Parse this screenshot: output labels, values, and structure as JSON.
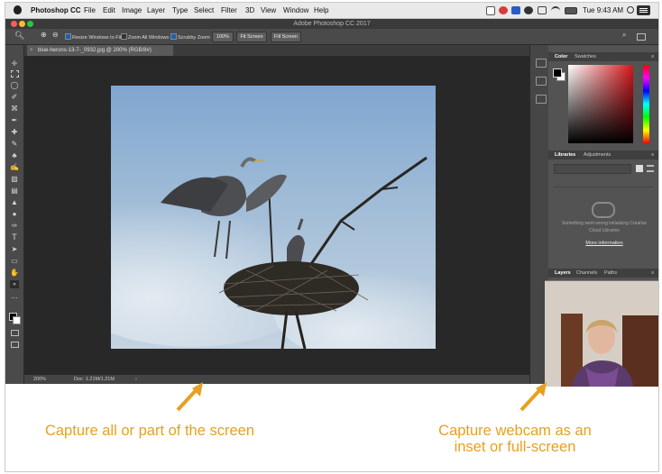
{
  "menubar": {
    "app_name": "Photoshop CC",
    "items": [
      "File",
      "Edit",
      "Image",
      "Layer",
      "Type",
      "Select",
      "Filter",
      "3D",
      "View",
      "Window",
      "Help"
    ],
    "clock": "Tue 9:43 AM"
  },
  "window": {
    "title": "Adobe Photoshop CC 2017"
  },
  "options_bar": {
    "resize_windows_label": "Resize Windows to Fit",
    "zoom_all_windows_label": "Zoom All Windows",
    "scrubby_zoom_label": "Scrubby Zoom",
    "zoom_value": "100%",
    "fit_screen_label": "Fit Screen",
    "fill_screen_label": "Fill Screen"
  },
  "document": {
    "tab_title": "blue-herons-13-7-_0932.jpg @ 200% (RGB/8#)",
    "status_zoom": "200%",
    "status_doc": "Doc: 1.21M/1.21M"
  },
  "panels": {
    "color_tabs": [
      "Color",
      "Swatches"
    ],
    "library_tabs": [
      "Libraries",
      "Adjustments"
    ],
    "library_message": "Something went wrong initializing Creative Cloud Libraries",
    "library_link": "More information",
    "layer_tabs": [
      "Layers",
      "Channels",
      "Paths"
    ]
  },
  "captions": {
    "left": "Capture all or part of the screen",
    "right_line1": "Capture webcam as an",
    "right_line2": "inset or full-screen"
  },
  "colors": {
    "caption": "#e8a020",
    "accent": "#1a5fb4"
  }
}
